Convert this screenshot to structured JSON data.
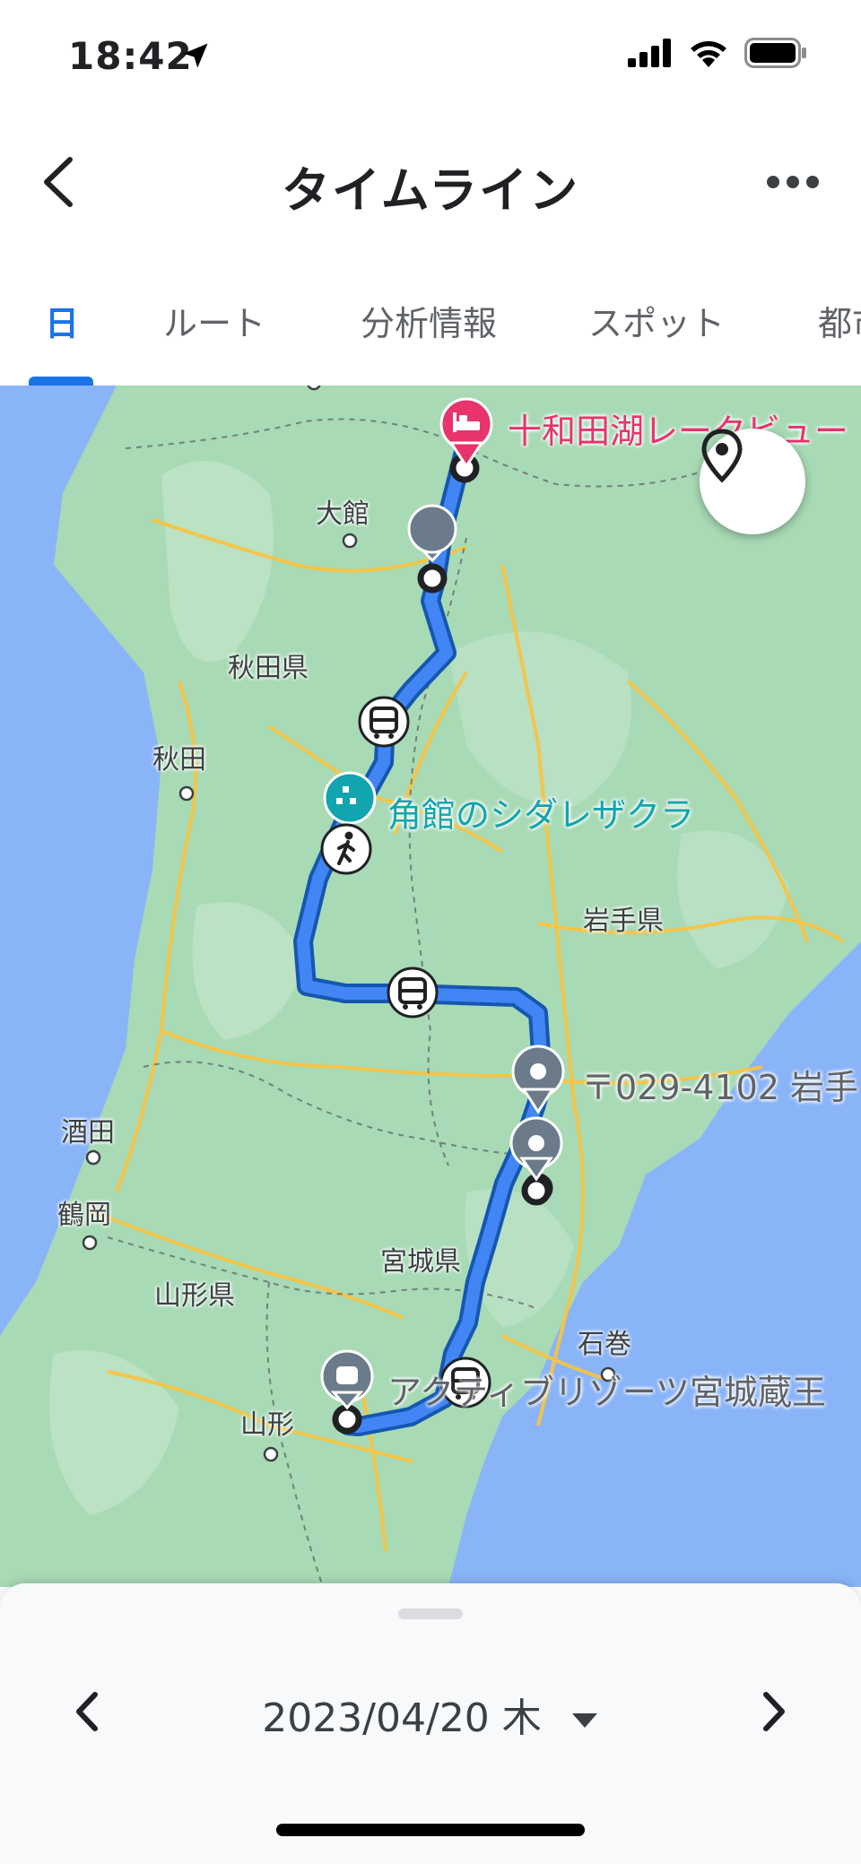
{
  "status_bar": {
    "time": "18:42"
  },
  "header": {
    "title": "タイムライン"
  },
  "tabs": [
    {
      "label": "日",
      "active": true
    },
    {
      "label": "ルート",
      "active": false
    },
    {
      "label": "分析情報",
      "active": false
    },
    {
      "label": "スポット",
      "active": false
    },
    {
      "label": "都市",
      "active": false
    }
  ],
  "map": {
    "places": {
      "hotel": "十和田湖レークビュー",
      "cherry_blossom": "角館のシダレザクラ",
      "postal": "〒029-4102 岩手",
      "resort": "アクティブリゾーツ宮城蔵王"
    },
    "labels": {
      "odate": "大館",
      "akita_pref": "秋田県",
      "akita": "秋田",
      "iwate_pref": "岩手県",
      "sakata": "酒田",
      "tsuruoka": "鶴岡",
      "miyagi_pref": "宮城県",
      "yamagata_pref": "山形県",
      "ishinomaki": "石巻",
      "yamagata": "山形"
    },
    "colors": {
      "route": "#1a73e8",
      "land": "#a8dab5",
      "water": "#8ab4f8",
      "hotel_pin": "#e8336d",
      "sight_pin": "#12a4af"
    }
  },
  "date_nav": {
    "date": "2023/04/20 木"
  }
}
